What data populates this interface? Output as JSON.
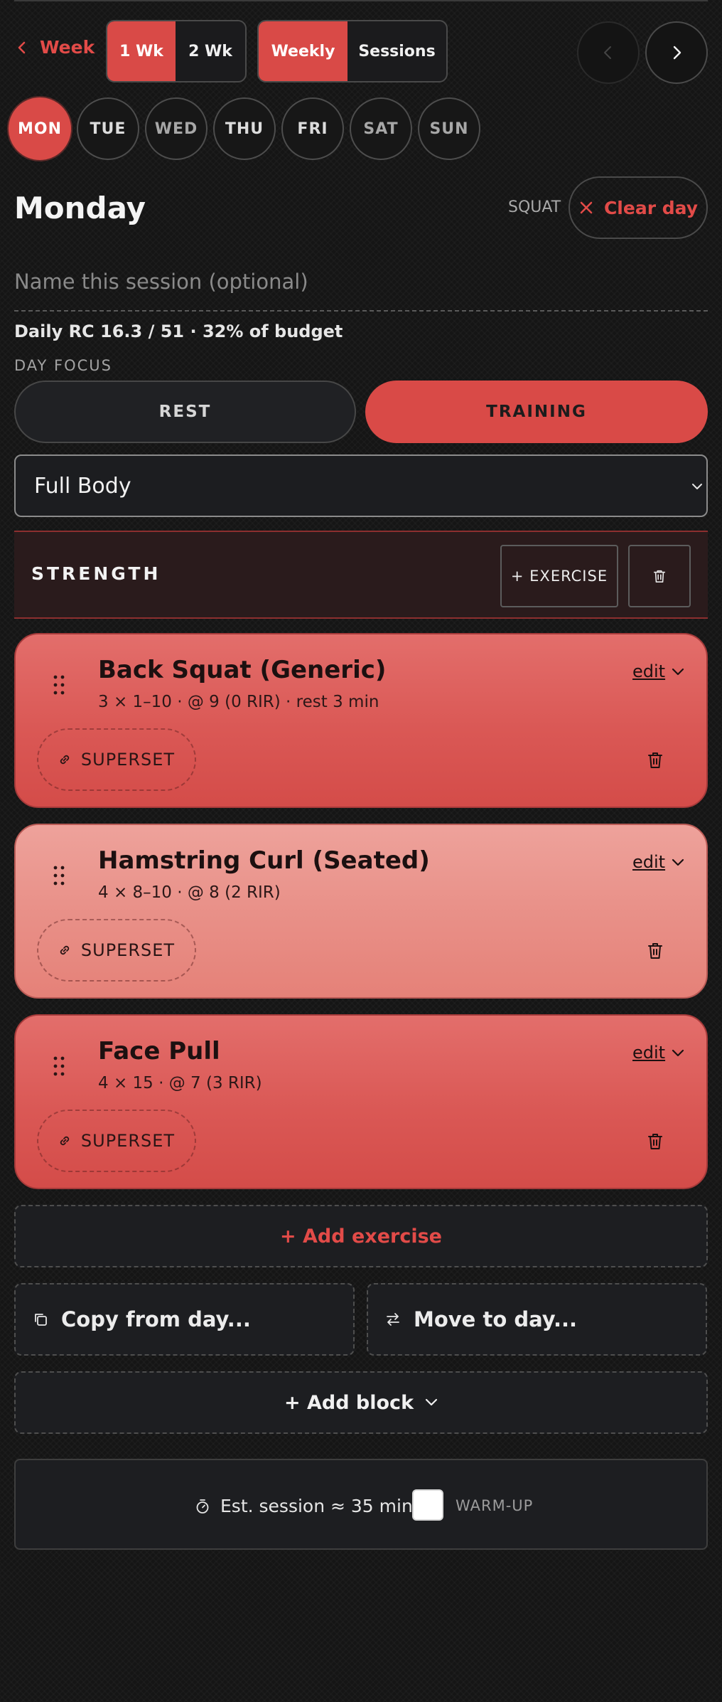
{
  "header": {
    "back_label": "Week",
    "span_options": [
      "1 Wk",
      "2 Wk"
    ],
    "view_options": [
      "Weekly",
      "Sessions"
    ]
  },
  "days": [
    "MON",
    "TUE",
    "WED",
    "THU",
    "FRI",
    "SAT",
    "SUN"
  ],
  "selected_day": "MON",
  "day": {
    "title": "Monday",
    "tag": "SQUAT",
    "clear_label": "Clear day",
    "session_placeholder": "Name this session (optional)",
    "budget_text": "Daily RC 16.3 / 51 · 32% of budget",
    "focus_label": "DAY FOCUS",
    "focus_options": [
      "REST",
      "TRAINING"
    ],
    "focus_selected": "TRAINING",
    "split_value": "Full Body"
  },
  "block": {
    "title": "STRENGTH",
    "add_exercise_label": "+ EXERCISE"
  },
  "exercises": [
    {
      "name": "Back Squat (Generic)",
      "detail": "3 × 1–10 · @ 9 (0 RIR) · rest 3 min",
      "edit_label": "edit",
      "superset_label": "SUPERSET",
      "color": "#da5855"
    },
    {
      "name": "Hamstring Curl (Seated)",
      "detail": "4 × 8–10 · @ 8 (2 RIR)",
      "edit_label": "edit",
      "superset_label": "SUPERSET",
      "color": "#e9928a"
    },
    {
      "name": "Face Pull",
      "detail": "4 × 15 · @ 7 (3 RIR)",
      "edit_label": "edit",
      "superset_label": "SUPERSET",
      "color": "#da5855"
    }
  ],
  "actions": {
    "add_exercise": "+ Add exercise",
    "copy_from_day": "Copy from day...",
    "move_to_day": "Move to day...",
    "add_block": "+ Add block"
  },
  "footer": {
    "estimate": "Est. session ≈ 35 min",
    "warmup_label": "WARM-UP",
    "warmup_checked": false
  },
  "colors": {
    "accent": "#d94a47",
    "accent_text": "#e24b48",
    "background": "#151515"
  }
}
